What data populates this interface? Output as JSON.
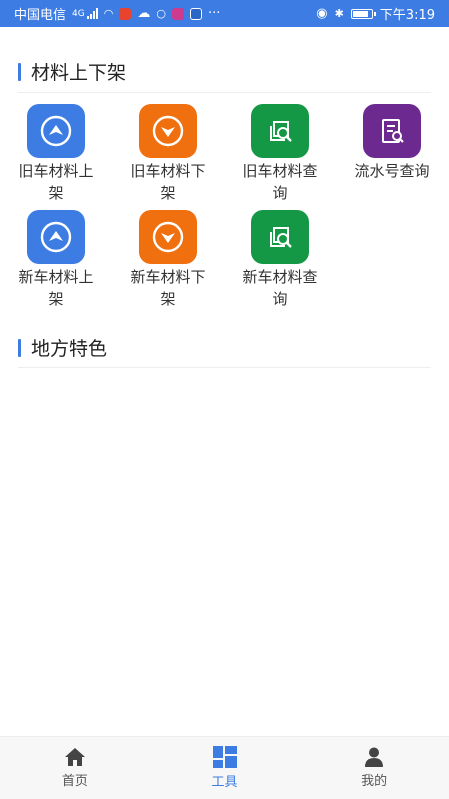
{
  "status_bar": {
    "carrier": "中国电信",
    "network": "4G",
    "time": "下午3:19",
    "battery_level": 0.9,
    "colors": {
      "background": "#3d7de3"
    }
  },
  "sections": [
    {
      "title": "材料上下架",
      "tiles": [
        {
          "label": "旧车材料上架",
          "icon": "arrow-up-circle-icon",
          "color": "#3d7de3"
        },
        {
          "label": "旧车材料下架",
          "icon": "arrow-down-circle-icon",
          "color": "#f0700f"
        },
        {
          "label": "旧车材料查询",
          "icon": "search-doc-icon",
          "color": "#159846"
        },
        {
          "label": "流水号查询",
          "icon": "doc-search-icon",
          "color": "#6c2a91"
        },
        {
          "label": "新车材料上架",
          "icon": "arrow-up-circle-icon",
          "color": "#3d7de3"
        },
        {
          "label": "新车材料下架",
          "icon": "arrow-down-circle-icon",
          "color": "#f0700f"
        },
        {
          "label": "新车材料查询",
          "icon": "search-doc-icon",
          "color": "#159846"
        }
      ]
    },
    {
      "title": "地方特色",
      "tiles": []
    }
  ],
  "bottom_nav": {
    "items": [
      {
        "label": "首页",
        "icon": "home-icon"
      },
      {
        "label": "工具",
        "icon": "grid-icon",
        "active": true
      },
      {
        "label": "我的",
        "icon": "user-icon"
      }
    ],
    "colors": {
      "active": "#3d7de3",
      "inactive": "#555555"
    }
  }
}
